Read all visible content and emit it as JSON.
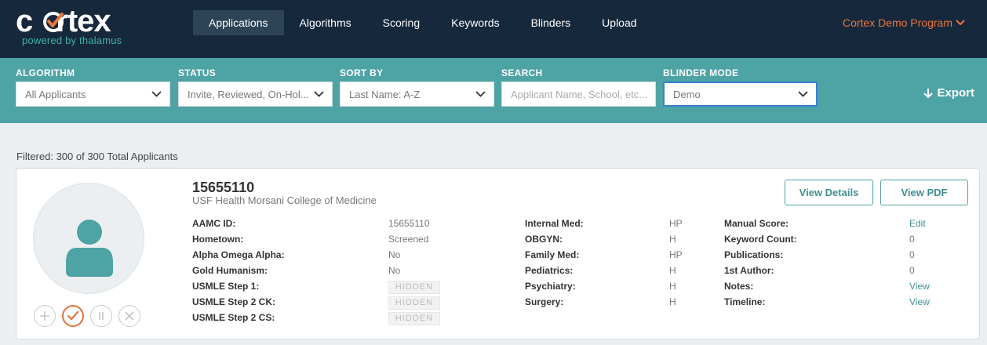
{
  "brand": {
    "logo_text": "cortex",
    "tagline": "powered by thalamus"
  },
  "nav": {
    "items": [
      {
        "label": "Applications",
        "active": true
      },
      {
        "label": "Algorithms"
      },
      {
        "label": "Scoring"
      },
      {
        "label": "Keywords"
      },
      {
        "label": "Blinders"
      },
      {
        "label": "Upload"
      }
    ],
    "program": "Cortex Demo Program"
  },
  "filters": {
    "algorithm": {
      "label": "ALGORITHM",
      "value": "All Applicants"
    },
    "status": {
      "label": "STATUS",
      "value": "Invite, Reviewed, On-Hol..."
    },
    "sort_by": {
      "label": "SORT BY",
      "value": "Last Name: A-Z"
    },
    "search": {
      "label": "SEARCH",
      "value": "",
      "placeholder": "Applicant Name, School, etc..."
    },
    "blinder_mode": {
      "label": "BLINDER MODE",
      "value": "Demo"
    },
    "export_label": "Export"
  },
  "summary": "Filtered: 300 of 300 Total Applicants",
  "applicant": {
    "id": "15655110",
    "school": "USF Health Morsani College of Medicine",
    "view_details": "View Details",
    "view_pdf": "View PDF",
    "col1": [
      {
        "label": "AAMC ID:",
        "value": "15655110"
      },
      {
        "label": "Hometown:",
        "value": "Screened"
      },
      {
        "label": "Alpha Omega Alpha:",
        "value": "No"
      },
      {
        "label": "Gold Humanism:",
        "value": "No"
      },
      {
        "label": "USMLE Step 1:",
        "value": "HIDDEN"
      },
      {
        "label": "USMLE Step 2 CK:",
        "value": "HIDDEN"
      },
      {
        "label": "USMLE Step 2 CS:",
        "value": "HIDDEN"
      }
    ],
    "col2": [
      {
        "label": "Internal Med:",
        "value": "HP"
      },
      {
        "label": "OBGYN:",
        "value": "H"
      },
      {
        "label": "Family Med:",
        "value": "HP"
      },
      {
        "label": "Pediatrics:",
        "value": "H"
      },
      {
        "label": "Psychiatry:",
        "value": "H"
      },
      {
        "label": "Surgery:",
        "value": "H"
      }
    ],
    "col3": [
      {
        "label": "Manual Score:",
        "value": "Edit"
      },
      {
        "label": "Keyword Count:",
        "value": "0"
      },
      {
        "label": "Publications:",
        "value": "0"
      },
      {
        "label": "1st Author:",
        "value": "0"
      },
      {
        "label": "Notes:",
        "value": "View"
      },
      {
        "label": "Timeline:",
        "value": "View"
      }
    ]
  },
  "colors": {
    "nav_bg": "#16283b",
    "filter_bg": "#4ea3a4",
    "accent_orange": "#e8773f",
    "teal_link": "#3f8f92"
  }
}
